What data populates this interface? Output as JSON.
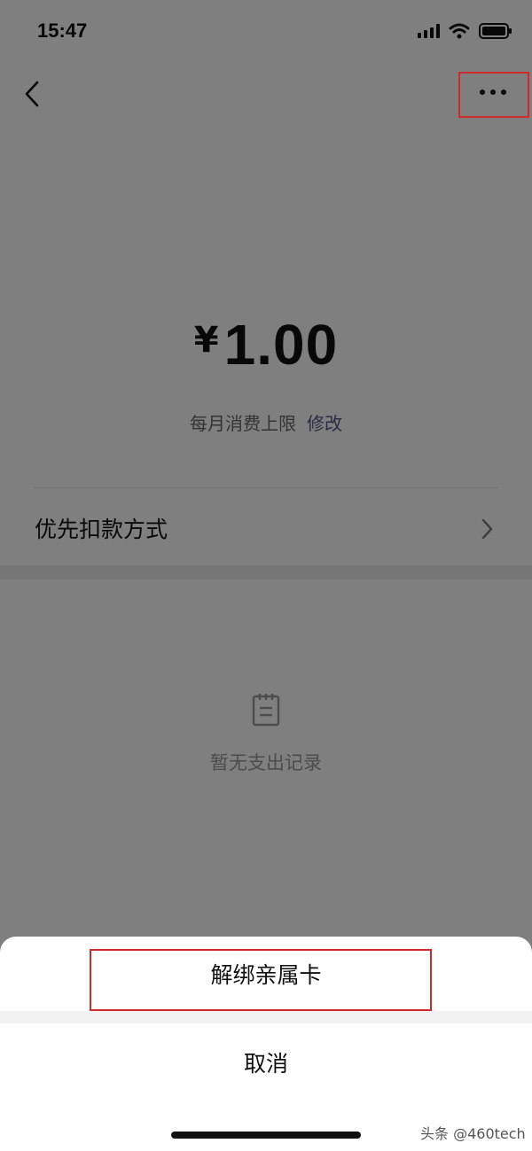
{
  "status_bar": {
    "time": "15:47"
  },
  "card": {
    "currency_symbol": "¥",
    "amount": "1.00",
    "limit_label": "每月消费上限",
    "edit_label": "修改",
    "payment_method_label": "优先扣款方式",
    "empty_text": "暂无支出记录"
  },
  "action_sheet": {
    "unbind_label": "解绑亲属卡",
    "cancel_label": "取消"
  },
  "watermark": "头条 @460tech",
  "colors": {
    "highlight": "#d12a2a",
    "link": "#4c5a8a"
  }
}
